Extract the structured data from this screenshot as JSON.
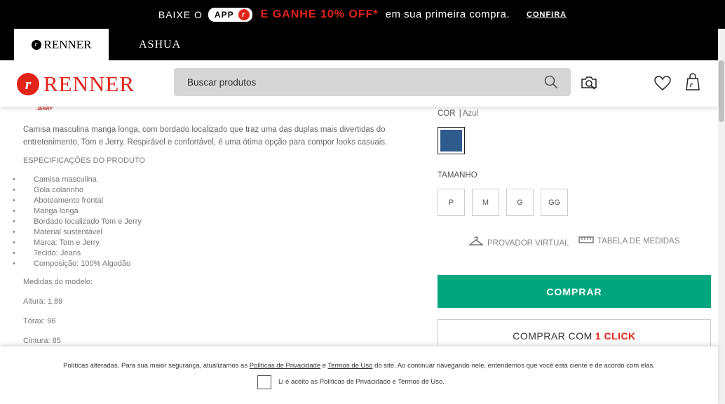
{
  "promo": {
    "baixe": "BAIXE O",
    "app": "APP",
    "ganhe": "E GANHE 10% OFF*",
    "primeira": "em sua primeira compra.",
    "confira": "CONFIRA"
  },
  "brands": {
    "renner": "RENNER",
    "ashua": "ASHUA"
  },
  "header": {
    "logo": "RENNER",
    "search_placeholder": "Buscar produtos"
  },
  "product": {
    "description": "Camisa masculina manga longa, com bordado localizado que traz uma das duplas mais divertidas do entretenimento, Tom e Jerry. Respirável e confortável, é uma ótima opção para compor looks casuais.",
    "spec_title": "ESPECIFICAÇÕES DO PRODUTO",
    "specs": [
      "Camisa masculina",
      "Gola colarinho",
      "Abotoamento frontal",
      "Manga longa",
      "Bordado localizado Tom e Jerry",
      "Material sustentável",
      "Marca: Tom e Jerry",
      "Tecido: Jeans",
      "Composição: 100% Algodão"
    ],
    "model_title": "Medidas do modelo:",
    "altura": "Altura: 1,89",
    "torax": "Tórax: 96",
    "cintura": "Cintura: 85"
  },
  "buybox": {
    "cor_label": "COR",
    "cor_sep": "|",
    "cor_value": "Azul",
    "swatch_color": "#2e5a8c",
    "tamanho_label": "TAMANHO",
    "sizes": [
      "P",
      "M",
      "G",
      "GG"
    ],
    "provador": "PROVADOR VIRTUAL",
    "tabela": "TABELA DE MEDIDAS",
    "comprar": "COMPRAR",
    "oneclick_prefix": "COMPRAR COM",
    "oneclick_highlight": "1 CLICK",
    "comprar_color": "#00a67e"
  },
  "policy": {
    "text_1": "Políticas alteradas. Para sua maior segurança, atualizamos as",
    "link_1": "Políticas de Privacidade",
    "text_2": "e",
    "link_2": "Termos de Uso",
    "text_3": "do site. Ao continuar navegando nele, entendemos que você está ciente e de acordo com elas.",
    "accept": "Li e aceito as Políticas de Privacidade e Termos de Uso."
  }
}
